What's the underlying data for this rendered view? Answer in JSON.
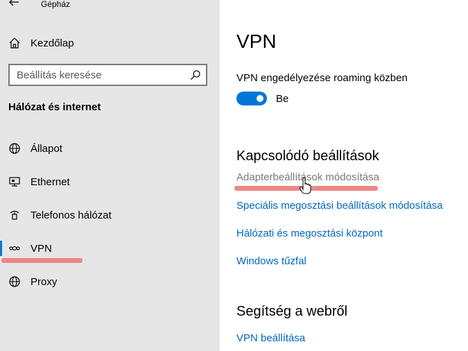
{
  "window": {
    "title": "Gépház"
  },
  "sidebar": {
    "home_label": "Kezdőlap",
    "search_placeholder": "Beállítás keresése",
    "section_title": "Hálózat és internet",
    "items": [
      {
        "label": "Állapot",
        "icon": "globe-icon"
      },
      {
        "label": "Ethernet",
        "icon": "ethernet-monitor-icon"
      },
      {
        "label": "Telefonos hálózat",
        "icon": "dialup-icon"
      },
      {
        "label": "VPN",
        "icon": "vpn-icon"
      },
      {
        "label": "Proxy",
        "icon": "globe-icon"
      }
    ],
    "selected": "VPN"
  },
  "main": {
    "title": "VPN",
    "roaming_label": "VPN engedélyezése roaming közben",
    "roaming_toggle": {
      "on": true,
      "state_label": "Be"
    },
    "related": {
      "heading": "Kapcsolódó beállítások",
      "links": [
        "Adapterbeállítások módosítása",
        "Speciális megosztási beállítások módosítása",
        "Hálózati és megosztási központ",
        "Windows tűzfal"
      ]
    },
    "help": {
      "heading": "Segítség a webről",
      "links": [
        "VPN beállítása"
      ]
    }
  },
  "colors": {
    "accent": "#0078d7",
    "link": "#0067c0",
    "sidebar_bg": "#e6e6e6",
    "highlight_mark": "#f07a7a"
  }
}
